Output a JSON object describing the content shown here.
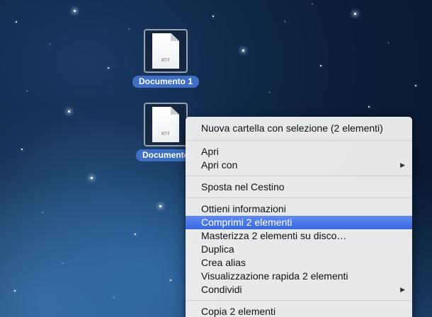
{
  "desktop": {
    "files": [
      {
        "name": "Documento 1",
        "type": "RTF"
      },
      {
        "name": "Documento",
        "type": "RTF"
      }
    ]
  },
  "context_menu": {
    "items": [
      {
        "label": "Nuova cartella con selezione (2 elementi)"
      },
      {
        "label": "Apri"
      },
      {
        "label": "Apri con",
        "submenu_icon": "chevron-right-icon"
      },
      {
        "label": "Sposta nel Cestino"
      },
      {
        "label": "Ottieni informazioni"
      },
      {
        "label": "Comprimi 2 elementi",
        "highlighted": true
      },
      {
        "label": "Masterizza 2 elementi su disco…"
      },
      {
        "label": "Duplica"
      },
      {
        "label": "Crea alias"
      },
      {
        "label": "Visualizzazione rapida 2 elementi"
      },
      {
        "label": "Condividi",
        "submenu_icon": "chevron-right-icon"
      },
      {
        "label": "Copia 2 elementi"
      }
    ],
    "highlight_color": "#3a67e0"
  }
}
